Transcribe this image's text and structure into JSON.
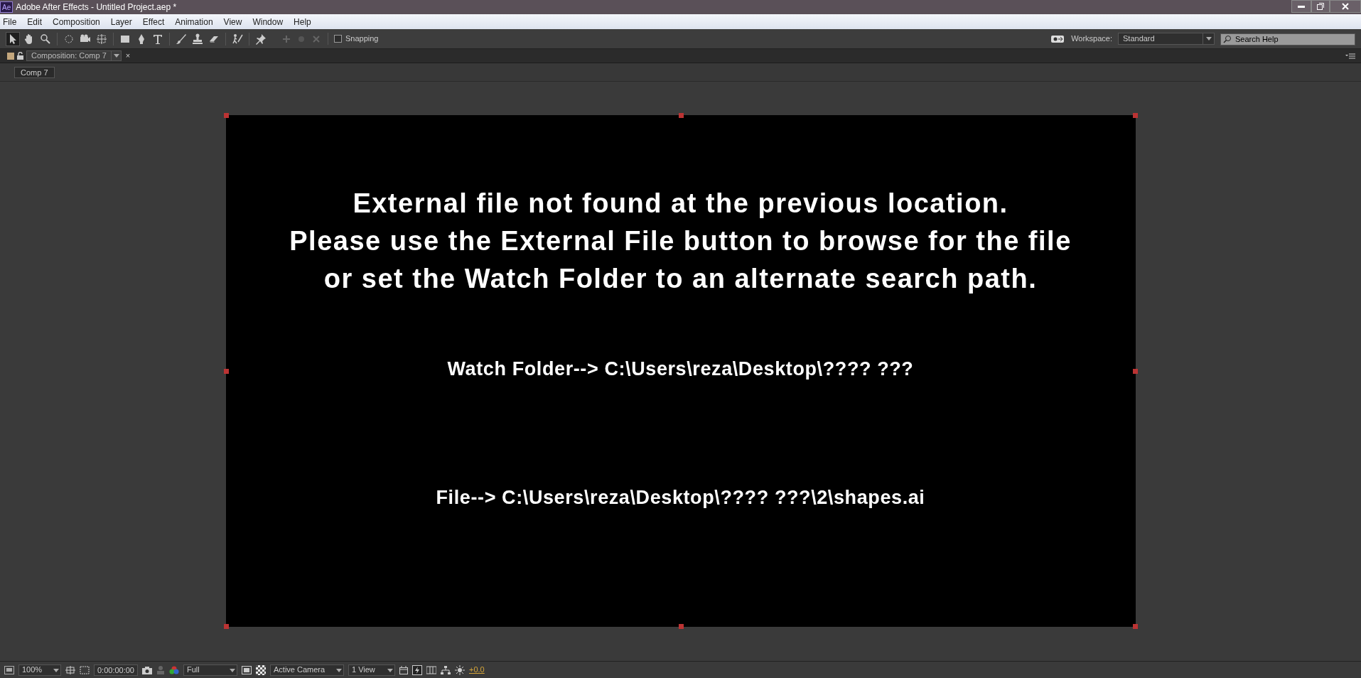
{
  "window": {
    "title": "Adobe After Effects - Untitled Project.aep *",
    "app_badge": "Ae"
  },
  "menu": [
    "File",
    "Edit",
    "Composition",
    "Layer",
    "Effect",
    "Animation",
    "View",
    "Window",
    "Help"
  ],
  "tools": [
    {
      "kind": "arrow",
      "selected": true
    },
    {
      "kind": "hand",
      "selected": false
    },
    {
      "kind": "zoom",
      "selected": false
    },
    {
      "kind": "rotate",
      "selected": false
    },
    {
      "kind": "camera",
      "selected": false
    },
    {
      "kind": "pan",
      "selected": false
    },
    {
      "kind": "rect",
      "selected": false
    },
    {
      "kind": "pen",
      "selected": false
    },
    {
      "kind": "text",
      "selected": false
    },
    {
      "kind": "brush",
      "selected": false
    },
    {
      "kind": "stamp",
      "selected": false
    },
    {
      "kind": "eraser",
      "selected": false
    },
    {
      "kind": "roto",
      "selected": false
    },
    {
      "kind": "pin",
      "selected": false
    }
  ],
  "snapping": {
    "label": "Snapping",
    "checked": false
  },
  "workspace": {
    "label": "Workspace:",
    "value": "Standard"
  },
  "search": {
    "placeholder": "Search Help"
  },
  "panel_tab": {
    "label": "Composition: Comp 7",
    "close": "×"
  },
  "breadcrumb": "Comp 7",
  "viewer": {
    "message": [
      "External file not found at the previous location.",
      "Please use the External File button to browse for the file",
      "or set the Watch Folder to an alternate search path."
    ],
    "watch_folder": "Watch Folder--> C:\\Users\\reza\\Desktop\\???? ???",
    "file": "File--> C:\\Users\\reza\\Desktop\\???? ???\\2\\shapes.ai"
  },
  "footer": {
    "zoom": "100%",
    "timecode": "0:00:00:00",
    "resolution": "Full",
    "camera": "Active Camera",
    "views": "1 View",
    "exposure": "+0.0"
  }
}
